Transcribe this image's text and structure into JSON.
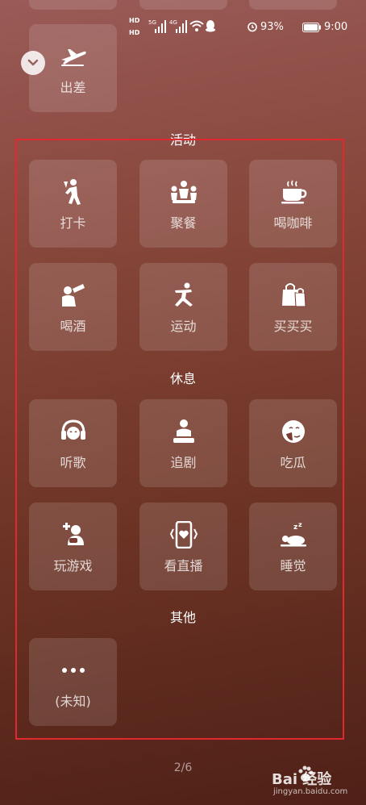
{
  "status": {
    "hd1": "HD",
    "hd2": "HD",
    "net1": "5G",
    "net2": "4G",
    "battery": "93%",
    "time": "9:00"
  },
  "top": {
    "label": "出差",
    "icon": "airplane-icon"
  },
  "sections": {
    "activity": "活动",
    "rest": "休息",
    "other": "其他"
  },
  "tiles": {
    "checkin": {
      "label": "打卡",
      "icon": "walking-person-icon"
    },
    "dinner": {
      "label": "聚餐",
      "icon": "group-people-icon"
    },
    "coffee": {
      "label": "喝咖啡",
      "icon": "coffee-cup-icon"
    },
    "drink": {
      "label": "喝酒",
      "icon": "drinking-bottle-icon"
    },
    "sport": {
      "label": "运动",
      "icon": "running-person-icon"
    },
    "shopping": {
      "label": "买买买",
      "icon": "shopping-bag-icon"
    },
    "music": {
      "label": "听歌",
      "icon": "headphones-icon"
    },
    "drama": {
      "label": "追剧",
      "icon": "watching-tv-icon"
    },
    "melon": {
      "label": "吃瓜",
      "icon": "gossip-face-icon"
    },
    "gaming": {
      "label": "玩游戏",
      "icon": "gamer-icon"
    },
    "live": {
      "label": "看直播",
      "icon": "phone-live-icon"
    },
    "sleep": {
      "label": "睡觉",
      "icon": "sleeping-icon"
    },
    "unknown": {
      "label": "(未知)",
      "icon": "more-dots-icon"
    }
  },
  "pager": "2/6",
  "watermark": {
    "brand": "Bai 经验",
    "url": "jingyan.baidu.com"
  },
  "colors": {
    "highlight_box": "#e0282e"
  }
}
